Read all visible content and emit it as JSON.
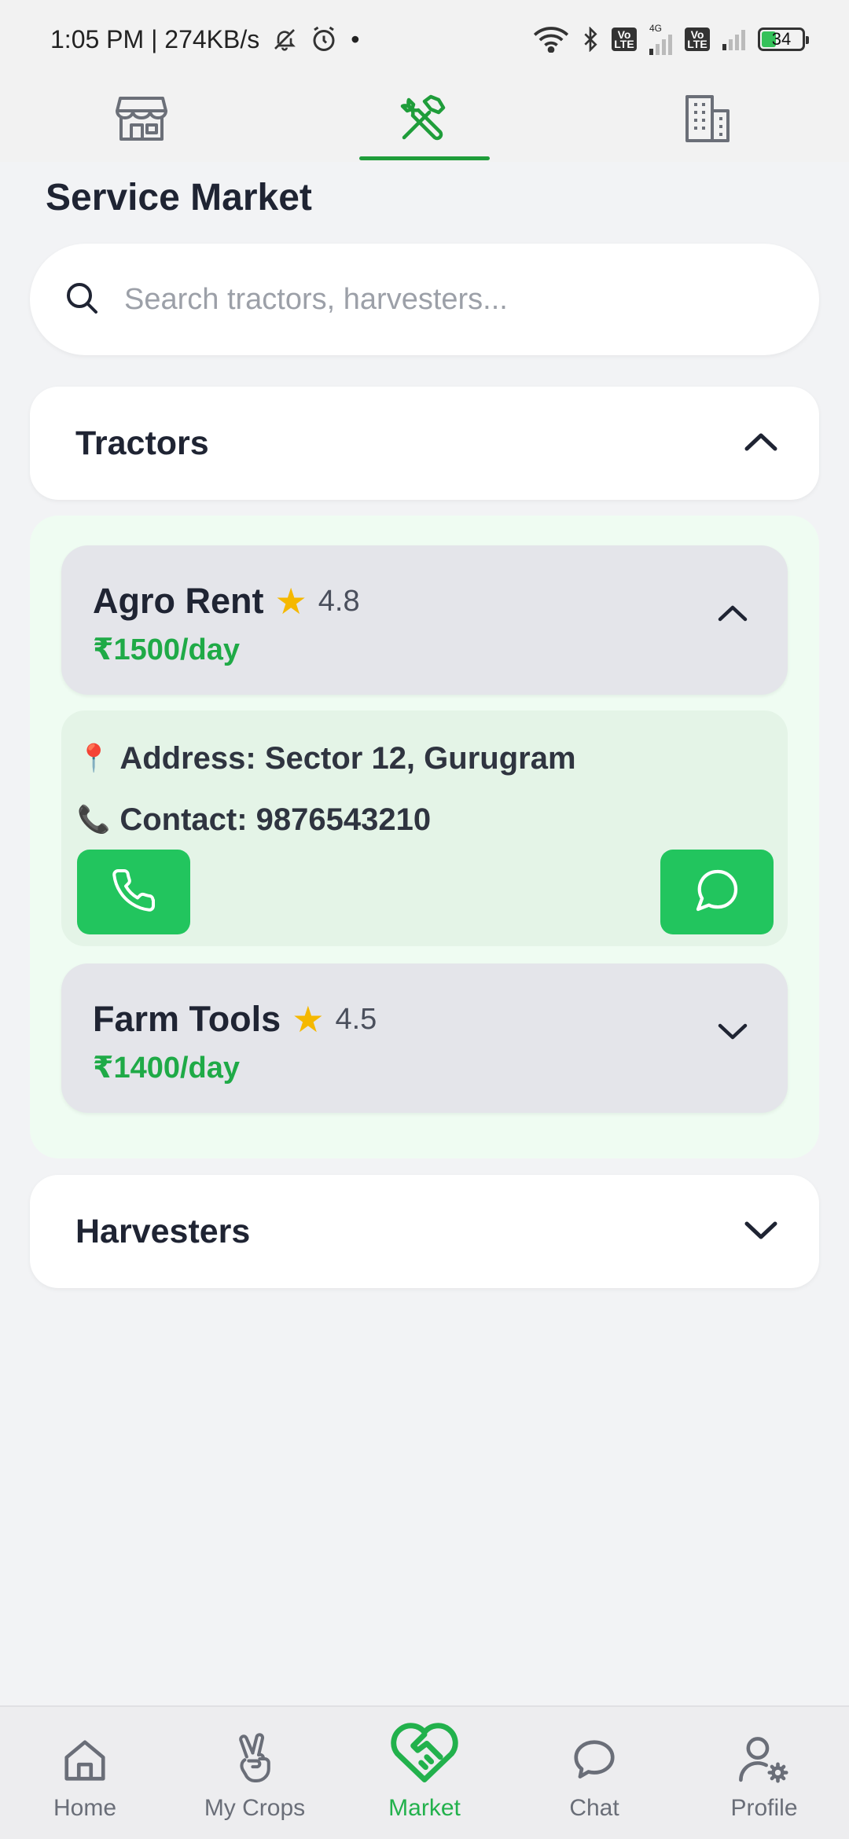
{
  "status_bar": {
    "time_speed": "1:05 PM | 274KB/s",
    "dot": "•",
    "network_label": "4G",
    "volte_label": "Vo LTE",
    "battery_level": "34"
  },
  "top_tabs": [
    {
      "icon": "storefront-icon",
      "active": false
    },
    {
      "icon": "tools-icon",
      "active": true
    },
    {
      "icon": "building-icon",
      "active": false
    }
  ],
  "page_title": "Service Market",
  "search": {
    "placeholder": "Search tractors, harvesters...",
    "value": ""
  },
  "sections": {
    "tractors": {
      "title": "Tractors",
      "expanded": true,
      "providers": [
        {
          "name": "Agro Rent",
          "star": "★",
          "rating": "4.8",
          "price": "₹1500/day",
          "expanded": true,
          "address": "Address: Sector 12, Gurugram",
          "contact": "Contact: 9876543210",
          "address_emoji": "📍",
          "contact_emoji": "📞"
        },
        {
          "name": "Farm Tools",
          "star": "★",
          "rating": "4.5",
          "price": "₹1400/day",
          "expanded": false
        }
      ]
    },
    "harvesters": {
      "title": "Harvesters",
      "expanded": false
    }
  },
  "bottom_nav": [
    {
      "label": "Home",
      "icon": "home-icon",
      "active": false
    },
    {
      "label": "My Crops",
      "icon": "peace-hand-icon",
      "active": false
    },
    {
      "label": "Market",
      "icon": "handshake-heart-icon",
      "active": true
    },
    {
      "label": "Chat",
      "icon": "chat-bubble-icon",
      "active": false
    },
    {
      "label": "Profile",
      "icon": "profile-gear-icon",
      "active": false
    }
  ],
  "colors": {
    "accent_green": "#22c55e",
    "price_green": "#1faa47",
    "tab_indicator": "#1f9d3a",
    "text_dark": "#1f2433",
    "star": "#f5b800"
  }
}
